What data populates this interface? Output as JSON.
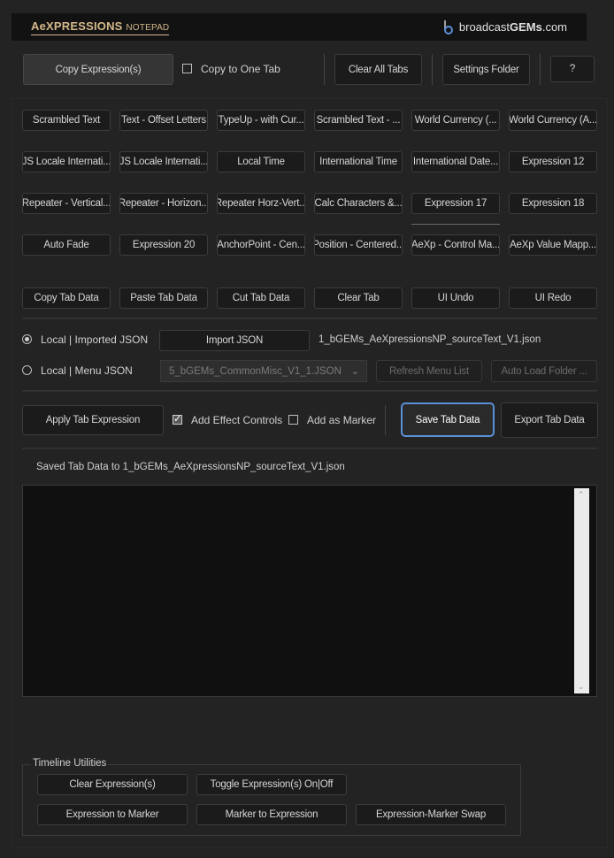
{
  "header": {
    "logo_main": "AeXPRESSIONS",
    "logo_sub": "NOTEPAD",
    "site_prefix": "broadcast",
    "site_bold": "GEMs",
    "site_suffix": ".com"
  },
  "toolbar": {
    "copy_expressions": "Copy Expression(s)",
    "copy_to_one_tab": "Copy to One Tab",
    "clear_all_tabs": "Clear All Tabs",
    "settings_folder": "Settings Folder",
    "help": "?"
  },
  "tabs": [
    [
      "Scrambled Text",
      "Text - Offset Letters",
      "TypeUp - with Cur...",
      "Scrambled Text - ...",
      "World Currency (...",
      "World Currency (A..."
    ],
    [
      "JS Locale Internati...",
      "JS Locale Internati...",
      "Local Time",
      "International Time",
      "International Date...",
      "Expression 12"
    ],
    [
      "Repeater - Vertical...",
      "Repeater - Horizon...",
      "Repeater Horz-Vert...",
      "Calc Characters &...",
      "Expression 17",
      "Expression 18"
    ],
    [
      "Auto Fade",
      "Expression 20",
      "AnchorPoint - Cen...",
      "Position - Centered...",
      "AeXp - Control Ma...",
      "AeXp Value Mapp..."
    ]
  ],
  "tab_actions": [
    "Copy Tab Data",
    "Paste Tab Data",
    "Cut Tab Data",
    "Clear Tab",
    "UI Undo",
    "UI Redo"
  ],
  "json_source": {
    "local_imported_label": "Local | Imported JSON",
    "import_button": "Import JSON",
    "imported_file": "1_bGEMs_AeXpressionsNP_sourceText_V1.json",
    "local_menu_label": "Local | Menu JSON",
    "menu_selected": "5_bGEMs_CommonMisc_V1_1.JSON",
    "refresh_button": "Refresh Menu List",
    "auto_load_button": "Auto Load Folder ..."
  },
  "apply_row": {
    "apply_button": "Apply Tab Expression",
    "add_effect_controls": "Add Effect Controls",
    "add_as_marker": "Add as Marker",
    "save_button": "Save Tab Data",
    "export_button": "Export Tab Data"
  },
  "status": "Saved Tab Data to 1_bGEMs_AeXpressionsNP_sourceText_V1.json",
  "editor": {
    "value": ""
  },
  "timeline": {
    "legend": "Timeline Utilities",
    "clear_expressions": "Clear Expression(s)",
    "toggle_expressions": "Toggle Expression(s) On|Off",
    "expression_to_marker": "Expression to Marker",
    "marker_to_expression": "Marker to Expression",
    "expression_marker_swap": "Expression-Marker Swap"
  },
  "colors": {
    "accent": "#5b8fd6",
    "logo_gold": "#d4b98a",
    "background": "#232323"
  }
}
